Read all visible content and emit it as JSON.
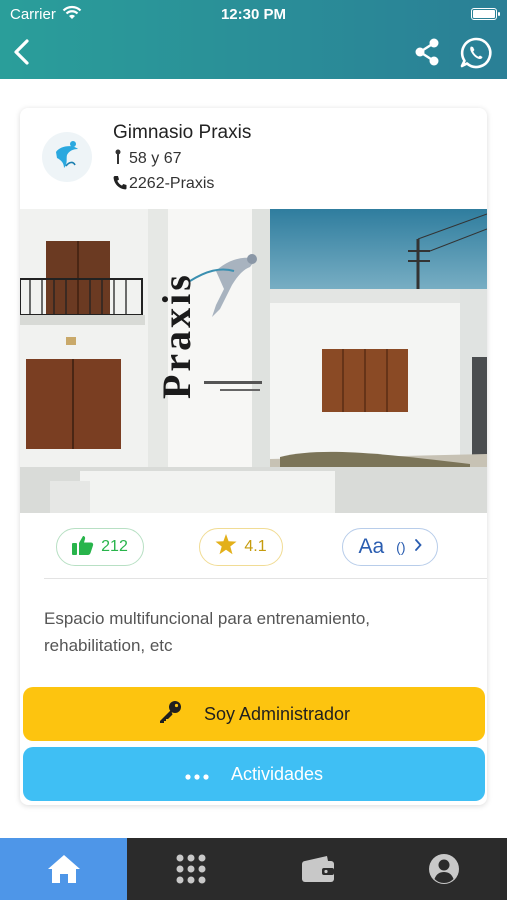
{
  "status_bar": {
    "carrier": "Carrier",
    "time": "12:30 PM"
  },
  "header": {
    "back_icon": "chevron-left-icon",
    "share_icon": "share-icon",
    "whatsapp_icon": "whatsapp-icon"
  },
  "place": {
    "name": "Gimnasio Praxis",
    "address": "58 y 67",
    "phone": "2262-Praxis",
    "photo_sign_text": "Praxis",
    "description": "Espacio multifuncional para entrenamiento, rehabilitation, etc"
  },
  "stats": {
    "likes": "212",
    "rating": "4.1",
    "lang_label": "Aa",
    "lang_value": "()",
    "like_icon": "thumbs-up-icon",
    "star_icon": "star-icon",
    "lang_icon": "chevron-right-icon"
  },
  "actions": {
    "admin_label": "Soy Administrador",
    "activities_label": "Actividades"
  },
  "tabs": [
    {
      "icon": "home-icon",
      "active": true
    },
    {
      "icon": "grid-icon",
      "active": false
    },
    {
      "icon": "wallet-icon",
      "active": false
    },
    {
      "icon": "user-icon",
      "active": false
    }
  ],
  "colors": {
    "header": "#2a8f98",
    "admin_button": "#fdc40f",
    "activities_button": "#3fbff4",
    "active_tab": "#4e96e8",
    "tab_bar": "#2b2b2b"
  }
}
